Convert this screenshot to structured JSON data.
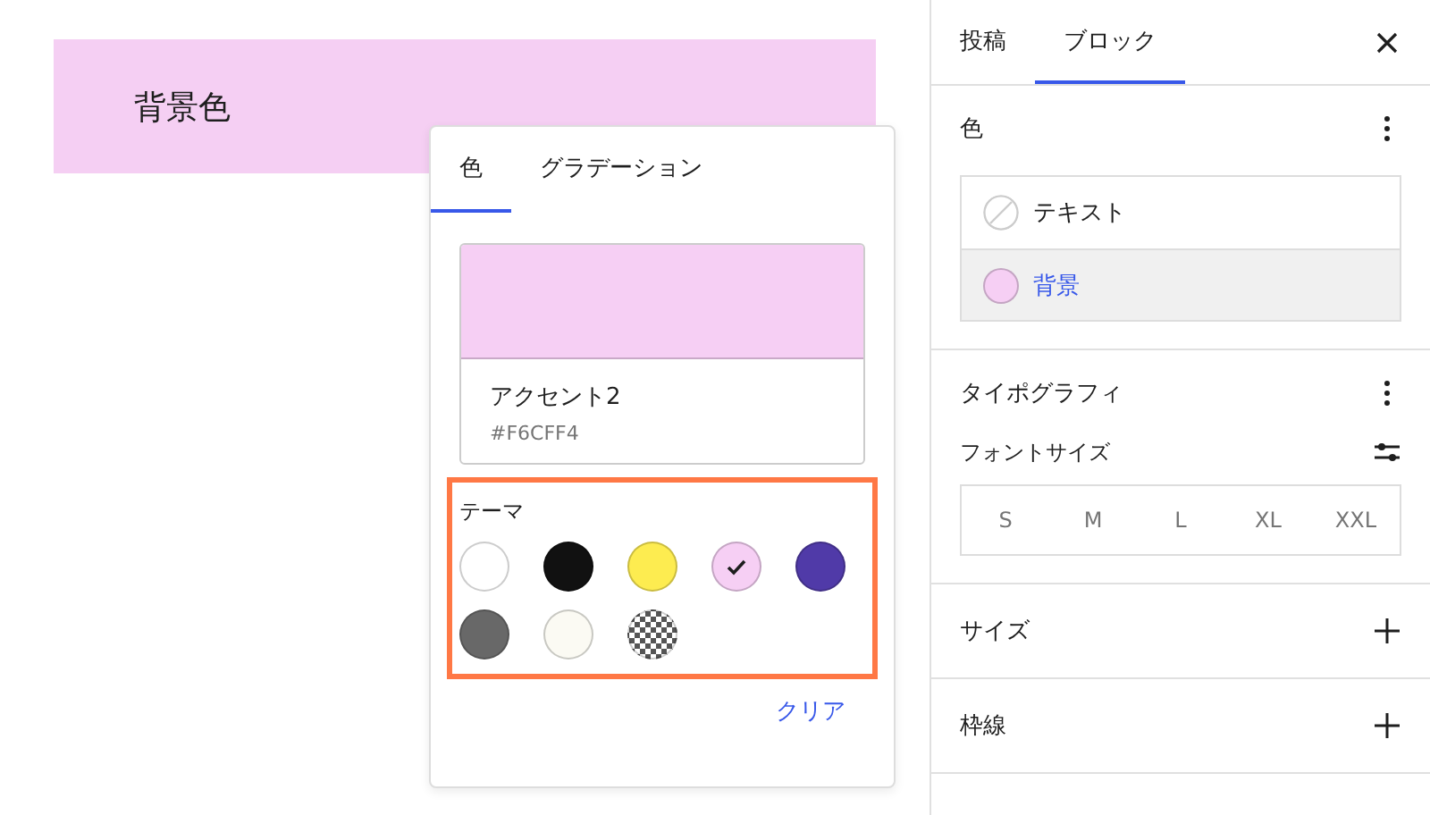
{
  "canvas": {
    "block_text": "背景色"
  },
  "popover": {
    "tabs": [
      {
        "label": "色",
        "selected": true
      },
      {
        "label": "グラデーション",
        "selected": false
      }
    ],
    "preview": {
      "name": "アクセント2",
      "hex": "#F6CFF4"
    },
    "palette": {
      "label": "テーマ",
      "swatches": [
        {
          "kind": "solid",
          "color": "#ffffff",
          "selected": false
        },
        {
          "kind": "solid",
          "color": "#111111",
          "selected": false
        },
        {
          "kind": "solid",
          "color": "#fdec50",
          "selected": false
        },
        {
          "kind": "solid",
          "color": "#f6cff4",
          "selected": true
        },
        {
          "kind": "solid",
          "color": "#503aa8",
          "selected": false
        },
        {
          "kind": "solid",
          "color": "#686868",
          "selected": false
        },
        {
          "kind": "solid",
          "color": "#fbfaf3",
          "selected": false
        },
        {
          "kind": "transparent",
          "selected": false
        }
      ]
    },
    "clear_label": "クリア"
  },
  "sidebar": {
    "tabs": [
      {
        "label": "投稿",
        "selected": false
      },
      {
        "label": "ブロック",
        "selected": true
      }
    ],
    "panels": [
      {
        "kind": "color",
        "title": "色",
        "items": [
          {
            "kind": "none",
            "label": "テキスト",
            "selected": false
          },
          {
            "kind": "swatch",
            "label": "背景",
            "color": "#f6cff4",
            "selected": true
          }
        ]
      },
      {
        "kind": "typography",
        "title": "タイポグラフィ",
        "font_size_label": "フォントサイズ",
        "sizes": [
          "S",
          "M",
          "L",
          "XL",
          "XXL"
        ]
      },
      {
        "kind": "collapsed",
        "title": "サイズ"
      },
      {
        "kind": "collapsed",
        "title": "枠線"
      }
    ]
  }
}
